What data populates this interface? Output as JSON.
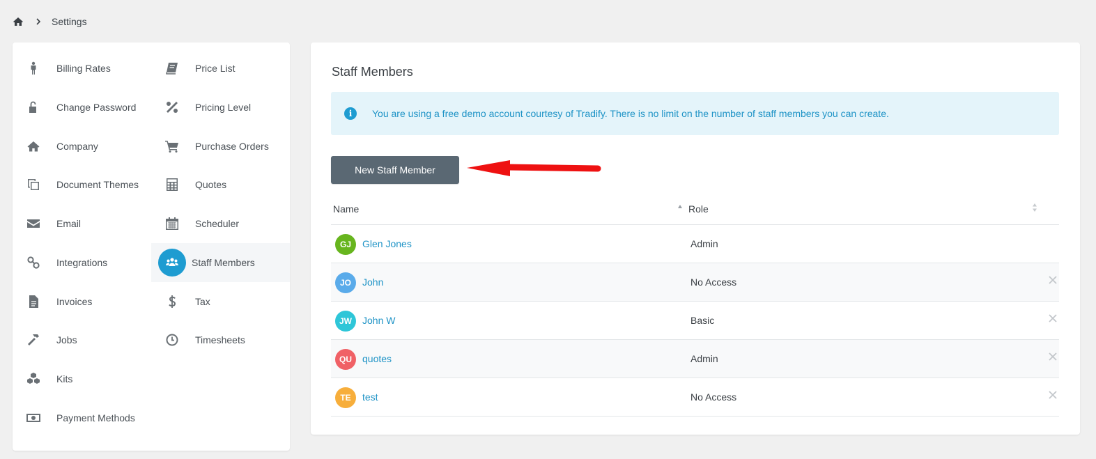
{
  "breadcrumb": {
    "home_icon": "home-icon",
    "current": "Settings"
  },
  "sidebar": {
    "left_items": [
      {
        "label": "Billing Rates",
        "icon": "person-icon"
      },
      {
        "label": "Change Password",
        "icon": "unlock-icon"
      },
      {
        "label": "Company",
        "icon": "home-icon"
      },
      {
        "label": "Document Themes",
        "icon": "copy-icon"
      },
      {
        "label": "Email",
        "icon": "envelope-icon"
      },
      {
        "label": "Integrations",
        "icon": "link-icon"
      },
      {
        "label": "Invoices",
        "icon": "file-icon"
      },
      {
        "label": "Jobs",
        "icon": "hammer-icon"
      },
      {
        "label": "Kits",
        "icon": "cubes-icon"
      },
      {
        "label": "Payment Methods",
        "icon": "money-icon"
      }
    ],
    "right_items": [
      {
        "label": "Price List",
        "icon": "book-icon"
      },
      {
        "label": "Pricing Level",
        "icon": "percent-icon"
      },
      {
        "label": "Purchase Orders",
        "icon": "cart-icon"
      },
      {
        "label": "Quotes",
        "icon": "calculator-icon"
      },
      {
        "label": "Scheduler",
        "icon": "calendar-icon"
      },
      {
        "label": "Staff Members",
        "icon": "users-icon",
        "active": true
      },
      {
        "label": "Tax",
        "icon": "dollar-icon"
      },
      {
        "label": "Timesheets",
        "icon": "clock-icon"
      }
    ]
  },
  "main": {
    "title": "Staff Members",
    "notice": "You are using a free demo account courtesy of Tradify. There is no limit on the number of staff members you can create.",
    "new_button": "New Staff Member",
    "table": {
      "headers": {
        "name": "Name",
        "role": "Role"
      },
      "rows": [
        {
          "initials": "GJ",
          "name": "Glen Jones",
          "role": "Admin",
          "color": "#67b51e",
          "deletable": false
        },
        {
          "initials": "JO",
          "name": "John",
          "role": "No Access",
          "color": "#5aabea",
          "deletable": true
        },
        {
          "initials": "JW",
          "name": "John W",
          "role": "Basic",
          "color": "#2ec6d8",
          "deletable": true
        },
        {
          "initials": "QU",
          "name": "quotes",
          "role": "Admin",
          "color": "#f06166",
          "deletable": true
        },
        {
          "initials": "TE",
          "name": "test",
          "role": "No Access",
          "color": "#f7ae3b",
          "deletable": true
        }
      ]
    }
  },
  "colors": {
    "accent": "#1e9cd1",
    "button": "#5a6873",
    "arrow": "#ee1111"
  }
}
